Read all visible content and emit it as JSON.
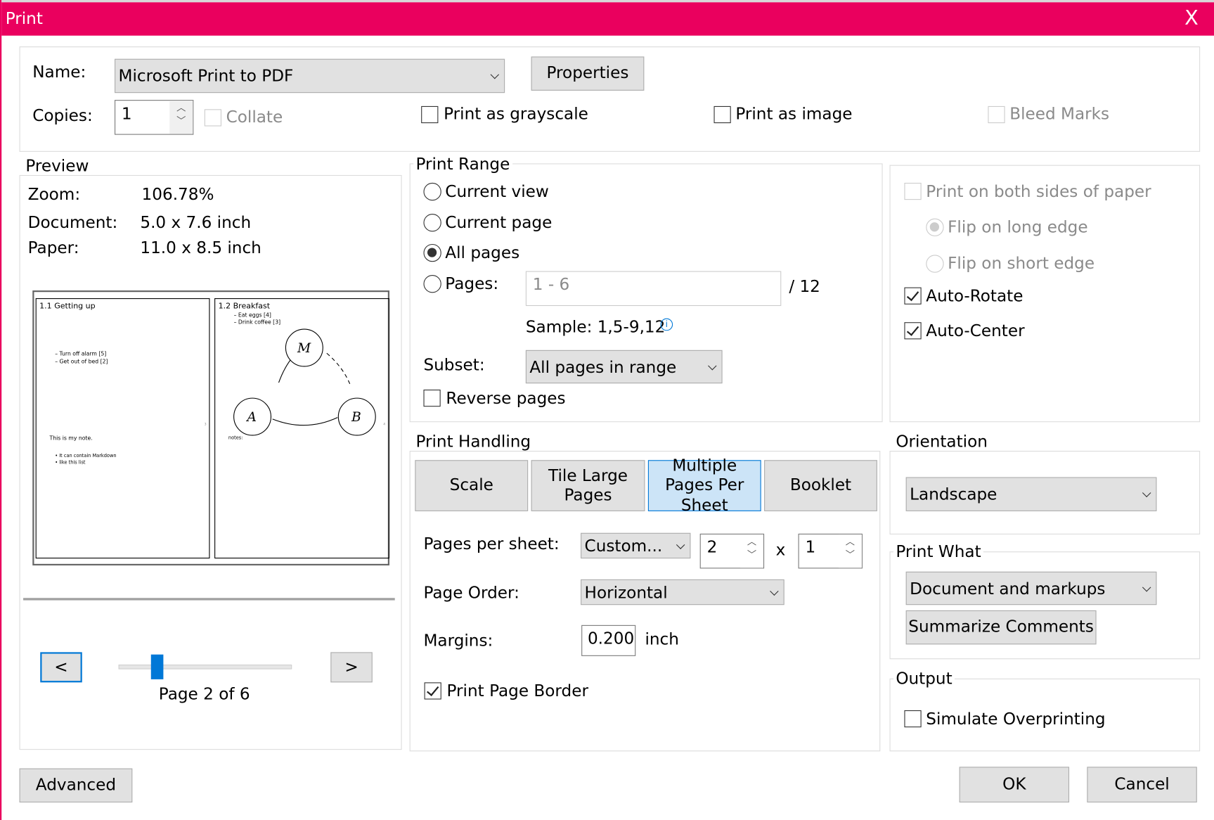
{
  "window": {
    "title": "Print",
    "close": "X"
  },
  "printer": {
    "name_label": "Name:",
    "name_value": "Microsoft Print to PDF",
    "properties": "Properties",
    "copies_label": "Copies:",
    "copies_value": "1",
    "collate": "Collate",
    "grayscale": "Print as grayscale",
    "as_image": "Print as image",
    "bleed": "Bleed Marks"
  },
  "preview": {
    "legend": "Preview",
    "zoom_label": "Zoom:",
    "zoom_value": "106.78%",
    "document_label": "Document:",
    "document_value": "5.0 x 7.6 inch",
    "paper_label": "Paper:",
    "paper_value": "11.0 x 8.5 inch",
    "prev": "<",
    "next": ">",
    "page_indicator": "Page 2 of 6",
    "slider_fraction": 0.2,
    "page1": {
      "heading": "1.1 Getting up",
      "items": [
        "– Turn off alarm [5]",
        "– Get out of bed [2]"
      ],
      "note": "This is my note.",
      "bullets": [
        "• It can contain Markdown",
        "• like this list"
      ],
      "num": "3"
    },
    "page2": {
      "heading": "1.2 Breakfast",
      "items": [
        "– Eat eggs [4]",
        "– Drink coffee [3]"
      ],
      "nodes": [
        "M",
        "A",
        "B"
      ],
      "notes": "notes:",
      "num": "4"
    }
  },
  "range": {
    "legend": "Print Range",
    "current_view": "Current view",
    "current_page": "Current page",
    "all_pages": "All pages",
    "pages": "Pages:",
    "pages_value": "1 - 6",
    "total": "/ 12",
    "sample": "Sample: 1,5-9,12",
    "subset_label": "Subset:",
    "subset_value": "All pages in range",
    "reverse": "Reverse pages"
  },
  "duplex": {
    "both_sides": "Print on both sides of paper",
    "long_edge": "Flip on long edge",
    "short_edge": "Flip on short edge",
    "auto_rotate": "Auto-Rotate",
    "auto_center": "Auto-Center"
  },
  "handling": {
    "legend": "Print Handling",
    "tabs": [
      "Scale",
      "Tile Large Pages",
      "Multiple Pages Per Sheet",
      "Booklet"
    ],
    "pps_label": "Pages per sheet:",
    "pps_value": "Custom...",
    "cols": "2",
    "x": "x",
    "rows": "1",
    "order_label": "Page Order:",
    "order_value": "Horizontal",
    "margins_label": "Margins:",
    "margins_value": "0.200",
    "margins_unit": "inch",
    "border": "Print Page Border"
  },
  "orientation": {
    "legend": "Orientation",
    "value": "Landscape"
  },
  "print_what": {
    "legend": "Print What",
    "value": "Document and markups",
    "summarize": "Summarize Comments"
  },
  "output": {
    "legend": "Output",
    "overprint": "Simulate Overprinting"
  },
  "footer": {
    "advanced": "Advanced",
    "ok": "OK",
    "cancel": "Cancel"
  },
  "colors": {
    "accent": "#ea005e",
    "selection": "#0078d7"
  }
}
